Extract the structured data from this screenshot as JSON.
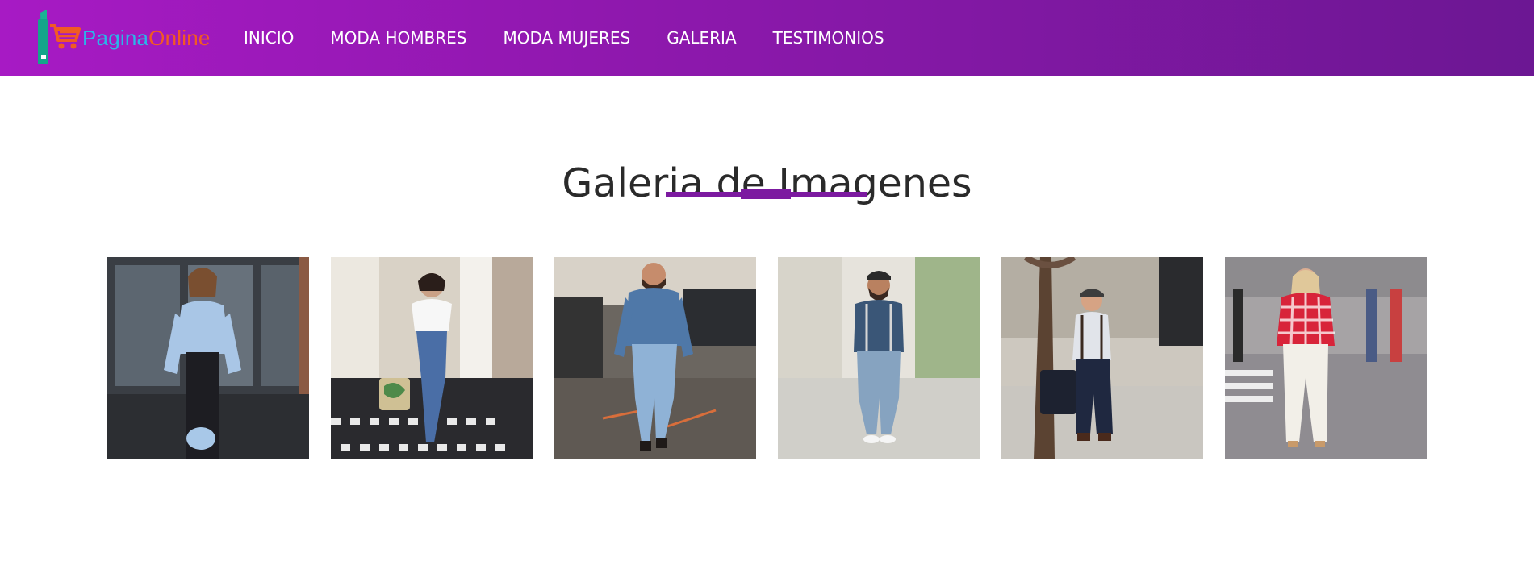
{
  "header": {
    "logo": {
      "text_part1": "Pagina",
      "text_part2": "Online",
      "icon": "shopping-cart-phone-logo"
    },
    "nav": [
      "INICIO",
      "MODA HOMBRES",
      "MODA MUJERES",
      "GALERIA",
      "TESTIMONIOS"
    ]
  },
  "main": {
    "title": "Galeria de Imagenes"
  },
  "gallery": {
    "images": [
      {
        "subject": "woman-light-blue-blouse"
      },
      {
        "subject": "woman-white-top-jeans-steps"
      },
      {
        "subject": "man-denim-jacket-jeans"
      },
      {
        "subject": "man-denim-shirt-suspenders-hat"
      },
      {
        "subject": "man-cap-suspenders-tree"
      },
      {
        "subject": "woman-red-checkered-shirt"
      }
    ]
  },
  "colors": {
    "header_start": "#a71ac4",
    "header_end": "#6c1793",
    "accent": "#7c1aa0",
    "logo_blue": "#2bb5e8",
    "logo_orange": "#f15a24"
  }
}
